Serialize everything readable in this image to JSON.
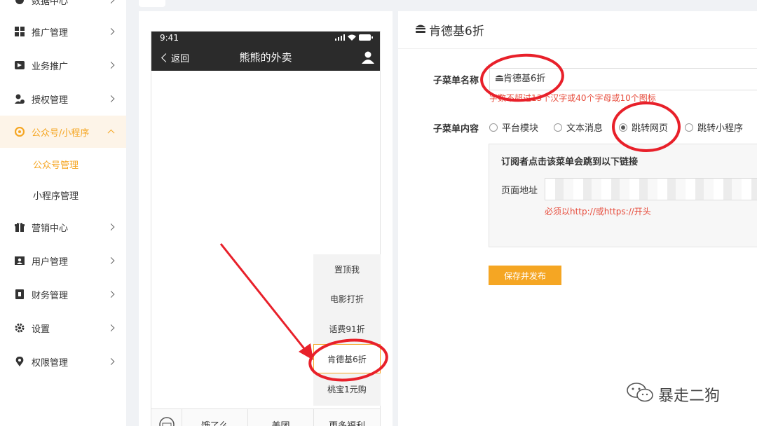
{
  "sidebar": {
    "items": [
      {
        "label": "数据中心"
      },
      {
        "label": "推广管理"
      },
      {
        "label": "业务推广"
      },
      {
        "label": "授权管理"
      },
      {
        "label": "公众号/小程序"
      },
      {
        "label": "营销中心"
      },
      {
        "label": "用户管理"
      },
      {
        "label": "财务管理"
      },
      {
        "label": "设置"
      },
      {
        "label": "权限管理"
      }
    ],
    "subitems": [
      {
        "label": "公众号管理"
      },
      {
        "label": "小程序管理"
      }
    ]
  },
  "phone": {
    "time": "9:41",
    "back_label": "返回",
    "title": "熊熊的外卖",
    "submenu": [
      {
        "label": "置顶我"
      },
      {
        "label": "电影打折"
      },
      {
        "label": "话费91折"
      },
      {
        "label": "肯德基6折"
      },
      {
        "label": "桃宝1元购"
      }
    ],
    "bottom_menu": [
      {
        "label": "饿了么"
      },
      {
        "label": "美团"
      },
      {
        "label": "更多福利"
      }
    ]
  },
  "form": {
    "title": "肯德基6折",
    "name_label": "子菜单名称",
    "name_value": "肯德基6折",
    "name_hint": "字数不超过13个汉字或40个字母或10个图标",
    "content_label": "子菜单内容",
    "radios": [
      {
        "label": "平台模块",
        "selected": false
      },
      {
        "label": "文本消息",
        "selected": false
      },
      {
        "label": "跳转网页",
        "selected": true
      },
      {
        "label": "跳转小程序",
        "selected": false
      }
    ],
    "link_box_title": "订阅者点击该菜单会跳到以下链接",
    "url_label": "页面地址",
    "url_hint": "必须以http://或https://开头",
    "save_button": "保存并发布"
  },
  "watermark": "暴走二狗",
  "colors": {
    "accent": "#f5a623",
    "annotation_red": "#e8202a",
    "hint_red": "#e74c3c"
  }
}
